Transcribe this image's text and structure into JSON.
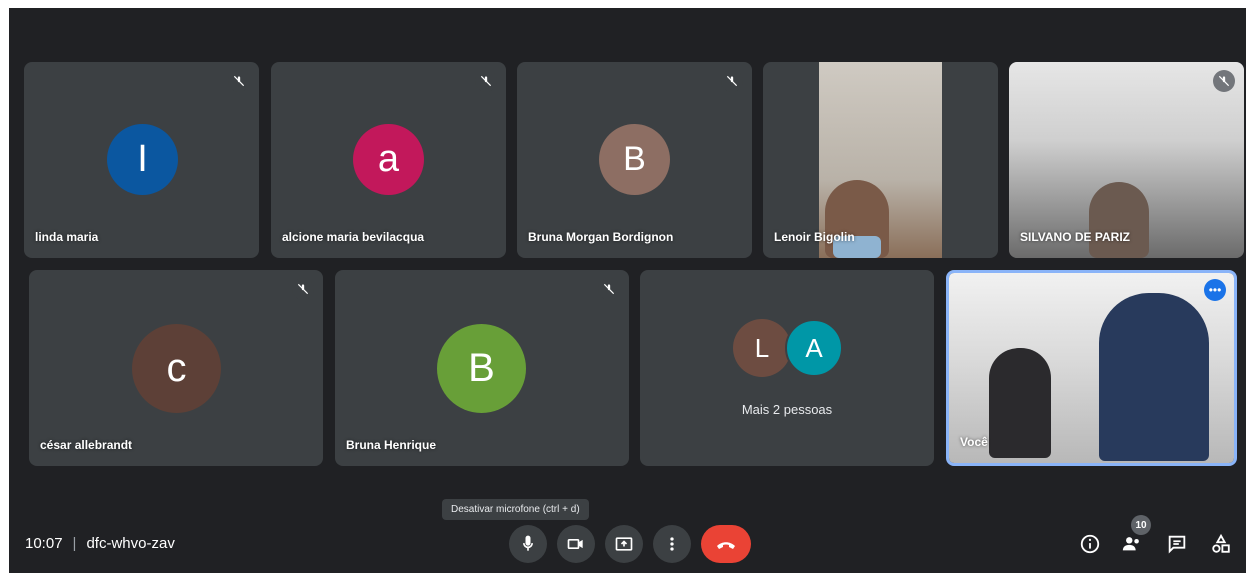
{
  "participants": [
    {
      "name": "linda maria",
      "initial": "I",
      "color": "#0b57a0"
    },
    {
      "name": "alcione maria bevilacqua",
      "initial": "a",
      "color": "#c2185b"
    },
    {
      "name": "Bruna Morgan Bordignon",
      "initial": "B",
      "color": "#8d6e63"
    },
    {
      "name": "Lenoir Bigolin"
    },
    {
      "name": "SILVANO DE PARIZ"
    },
    {
      "name": "césar allebrandt",
      "initial": "c",
      "color": "#5d4037"
    },
    {
      "name": "Bruna Henrique",
      "initial": "B",
      "color": "#689f38"
    },
    {
      "name": "Você"
    }
  ],
  "more_people": {
    "label": "Mais 2 pessoas",
    "avatars": [
      {
        "initial": "L",
        "color": "#6d4c41"
      },
      {
        "initial": "A",
        "color": "#0097a7"
      }
    ]
  },
  "meeting": {
    "time": "10:07",
    "separator": "|",
    "code": "dfc-whvo-zav"
  },
  "tooltip": "Desativar microfone (ctrl + d)",
  "participant_count": "10",
  "icons": {
    "mic": "microphone-icon",
    "camera": "camera-icon",
    "present": "present-screen-icon",
    "more": "more-options-icon",
    "end": "end-call-icon",
    "info": "info-icon",
    "people": "people-icon",
    "chat": "chat-icon",
    "activities": "activities-icon"
  },
  "colors": {
    "background": "#202124",
    "tile": "#3c4043",
    "end_call": "#ea4335",
    "self_border": "#8ab4f8"
  }
}
